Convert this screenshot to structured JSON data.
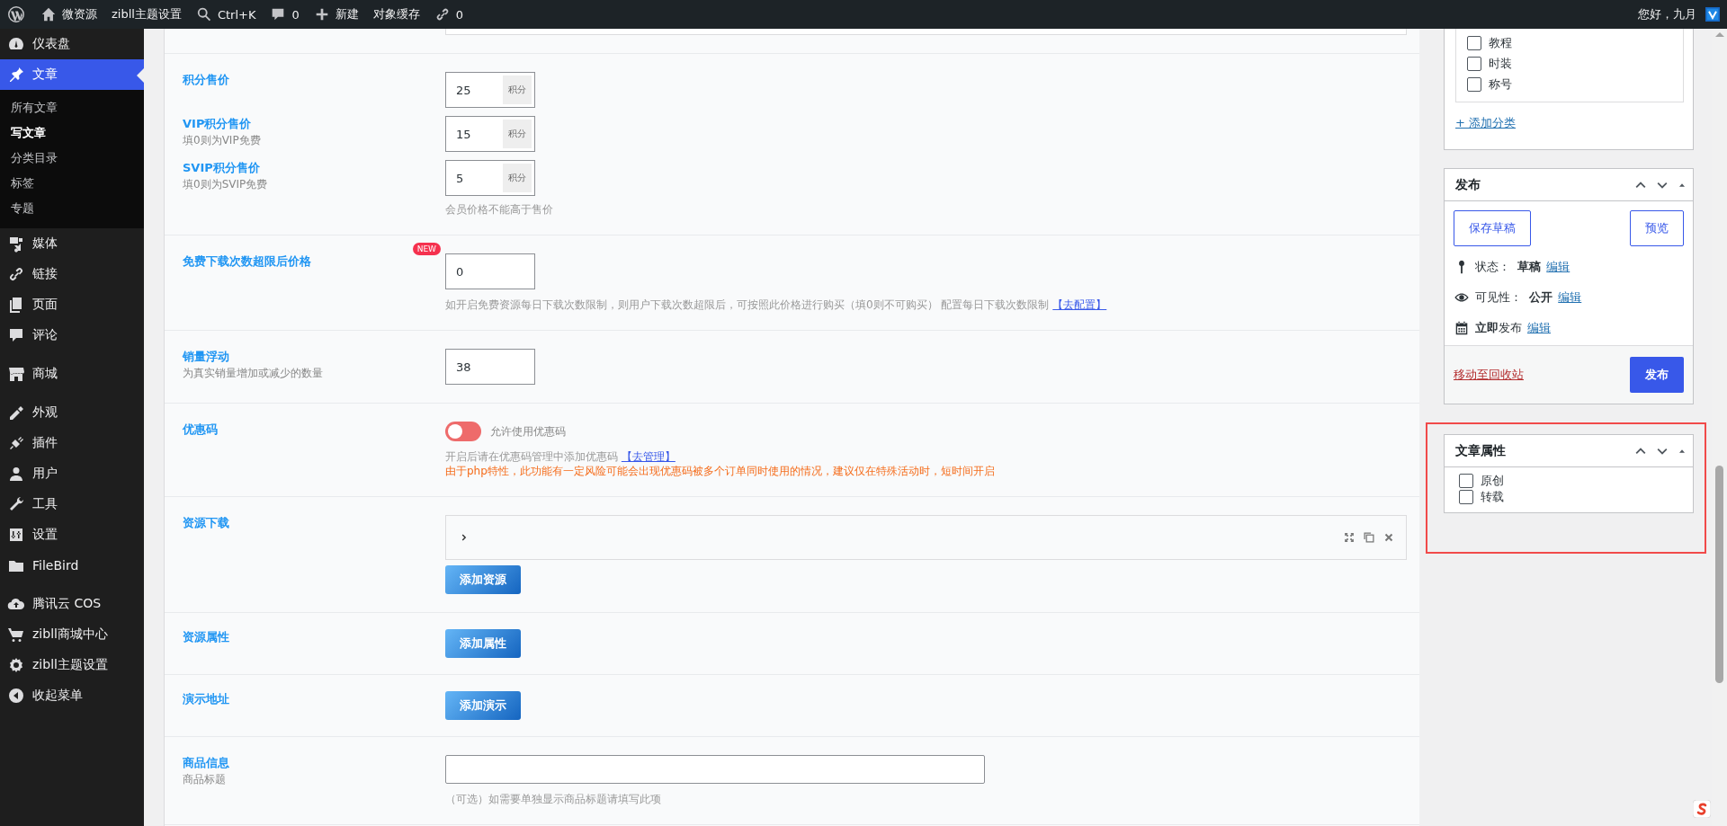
{
  "admin_bar": {
    "items": [
      {
        "kind": "logo"
      },
      {
        "kind": "home",
        "label": "微资源"
      },
      {
        "kind": "text",
        "label": "zibll主题设置"
      },
      {
        "kind": "search",
        "label": "Ctrl+K"
      },
      {
        "kind": "comments",
        "label": "0"
      },
      {
        "kind": "new",
        "label": "新建"
      },
      {
        "kind": "text",
        "label": "对象缓存"
      },
      {
        "kind": "link",
        "label": "0"
      }
    ],
    "greeting": "您好，九月"
  },
  "sidebar": {
    "groups": [
      {
        "items": [
          {
            "kind": "dashboard",
            "label": "仪表盘",
            "selected": false
          },
          {
            "kind": "pin",
            "label": "文章",
            "selected": true,
            "children": [
              {
                "label": "所有文章",
                "selected": false
              },
              {
                "label": "写文章",
                "selected": true
              },
              {
                "label": "分类目录",
                "selected": false
              },
              {
                "label": "标签",
                "selected": false
              },
              {
                "label": "专题",
                "selected": false
              }
            ]
          },
          {
            "kind": "media",
            "label": "媒体",
            "selected": false
          },
          {
            "kind": "link",
            "label": "链接",
            "selected": false
          },
          {
            "kind": "page",
            "label": "页面",
            "selected": false
          },
          {
            "kind": "comment",
            "label": "评论",
            "selected": false
          }
        ]
      },
      {
        "items": [
          {
            "kind": "store",
            "label": "商城",
            "selected": false
          }
        ]
      },
      {
        "items": [
          {
            "kind": "brush",
            "label": "外观",
            "selected": false
          },
          {
            "kind": "plugin",
            "label": "插件",
            "selected": false
          },
          {
            "kind": "user",
            "label": "用户",
            "selected": false
          },
          {
            "kind": "tool",
            "label": "工具",
            "selected": false
          },
          {
            "kind": "settings",
            "label": "设置",
            "selected": false
          },
          {
            "kind": "folder",
            "label": "FileBird",
            "selected": false
          }
        ]
      },
      {
        "items": [
          {
            "kind": "cloud",
            "label": "腾讯云 COS",
            "selected": false
          },
          {
            "kind": "cart",
            "label": "zibll商城中心",
            "selected": false
          },
          {
            "kind": "gear",
            "label": "zibll主题设置",
            "selected": false
          },
          {
            "kind": "collapse",
            "label": "收起菜单",
            "selected": false
          }
        ]
      }
    ]
  },
  "form": {
    "rows": [
      {
        "kind": "cut"
      },
      {
        "kind": "prices",
        "fields": [
          {
            "label": "积分售价",
            "value": "25",
            "unit": "积分"
          },
          {
            "label": "VIP积分售价",
            "hint": "填0则为VIP免费",
            "value": "15",
            "unit": "积分"
          },
          {
            "label": "SVIP积分售价",
            "hint": "填0则为SVIP免费",
            "value": "5",
            "unit": "积分"
          }
        ],
        "note": "会员价格不能高于售价"
      },
      {
        "kind": "number",
        "label": "免费下载次数超限后价格",
        "badge": "NEW",
        "value": "0",
        "note": "如开启免费资源每日下载次数限制，则用户下载次数超限后，可按照此价格进行购买（填0则不可购买） 配置每日下载次数限制",
        "link": "【去配置】"
      },
      {
        "kind": "number",
        "label": "销量浮动",
        "hint": "为真实销量增加或减少的数量",
        "value": "38"
      },
      {
        "kind": "toggle",
        "label": "优惠码",
        "toggle": {
          "on": false,
          "label": "允许使用优惠码"
        },
        "note": "开启后请在优惠码管理中添加优惠码",
        "link": "【去管理】",
        "warning": "由于php特性，此功能有一定风险可能会出现优惠码被多个订单同时使用的情况，建议仅在特殊活动时，短时间开启"
      },
      {
        "kind": "repeater",
        "label": "资源下载",
        "button": "添加资源"
      },
      {
        "kind": "button",
        "label": "资源属性",
        "button": "添加属性"
      },
      {
        "kind": "button",
        "label": "演示地址",
        "button": "添加演示"
      },
      {
        "kind": "text",
        "label": "商品信息",
        "hint": "商品标题",
        "note": "（可选）如需要单独显示商品标题请填写此项"
      }
    ]
  },
  "categories": {
    "items": [
      {
        "label": "教程",
        "checked": false
      },
      {
        "label": "时装",
        "checked": false
      },
      {
        "label": "称号",
        "checked": false
      }
    ],
    "add_link": "+ 添加分类"
  },
  "publish": {
    "title": "发布",
    "save_draft": "保存草稿",
    "preview": "预览",
    "lines": [
      {
        "kind": "status",
        "text": "状态：  **草稿**",
        "link": "编辑"
      },
      {
        "kind": "visibility",
        "text": "可见性：  **公开**",
        "link": "编辑"
      },
      {
        "kind": "schedule",
        "text": "**立即**发布",
        "link": "编辑"
      }
    ],
    "trash": "移动至回收站",
    "publish": "发布"
  },
  "attributes": {
    "title": "文章属性",
    "highlighted": true,
    "options": [
      {
        "label": "原创",
        "checked": false
      },
      {
        "label": "转载",
        "checked": false
      }
    ]
  }
}
